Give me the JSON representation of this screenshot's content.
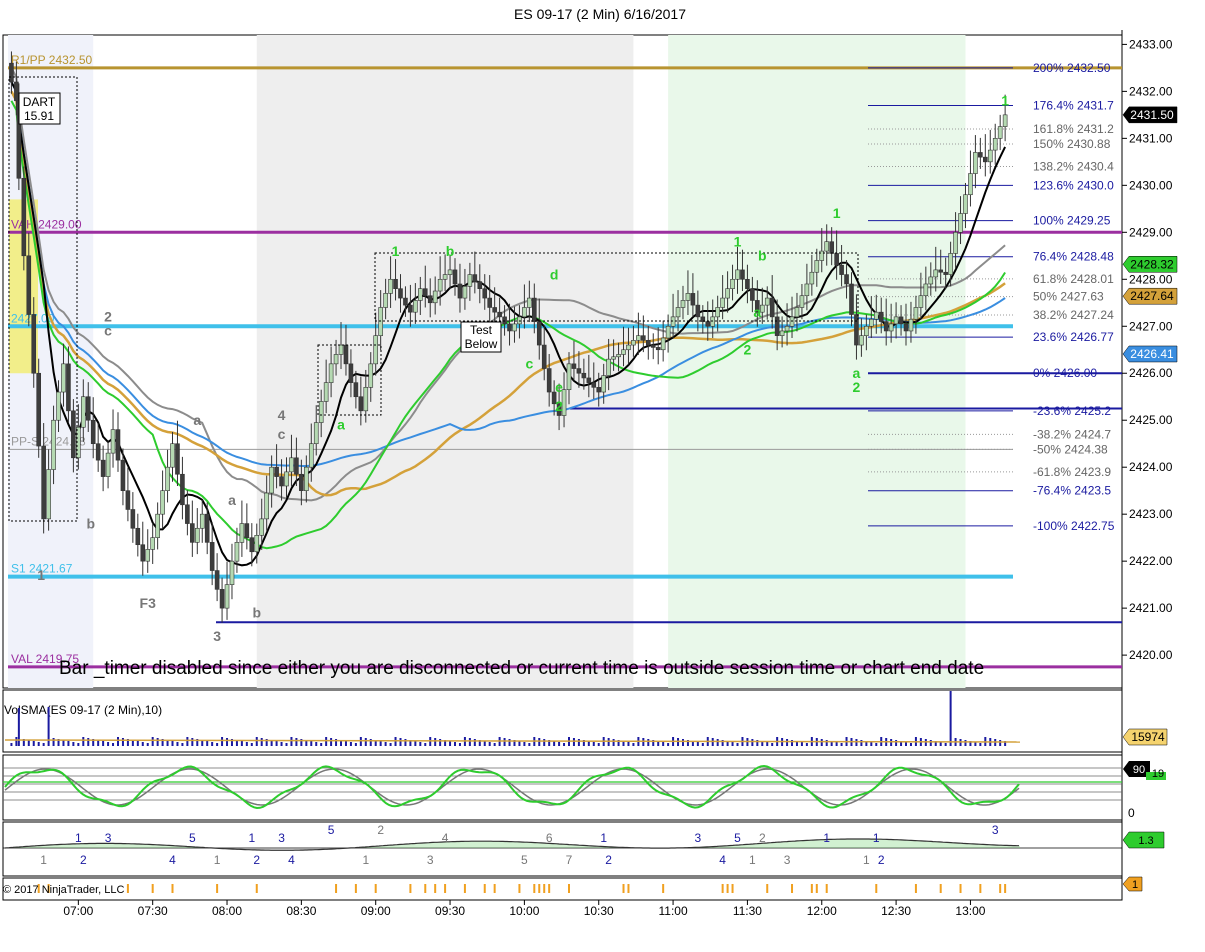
{
  "title": "ES 09-17 (2 Min)  6/16/2017",
  "copyright": "© 2017 NinjaTrader, LLC",
  "bar_timer_message": "Bar _timer disabled since either you are disconnected or current time is outside session time or chart end date",
  "dart_box": {
    "line1": "DART",
    "line2": "15.91"
  },
  "test_below": {
    "line1": "Test",
    "line2": "Below"
  },
  "colors": {
    "bg": "#ffffff",
    "session_shade": "#eeeeee",
    "early_shade": "#f0f2fa",
    "green_shade": "#e9f8ea",
    "up_bar": "#b5d9b2",
    "down_bar": "#3d3d3d",
    "fib": "#1a1aa0",
    "ema_black": "#000000",
    "ma_gray": "#8c8c8c",
    "ma_gold": "#d4a13a",
    "ma_blue": "#3a8ee0",
    "ma_green": "#2ecc2e",
    "pivot_line": "#b89430",
    "cyan": "#3fc0ea",
    "purple": "#9b2fa0"
  },
  "chart_data": {
    "type": "candlestick",
    "instrument": "ES 09-17",
    "interval": "2 Min",
    "date": "6/16/2017",
    "y_axis": {
      "min": 2419.3,
      "max": 2433.2,
      "ticks": [
        2433.0,
        2432.0,
        2431.0,
        2430.0,
        2429.0,
        2428.0,
        2427.0,
        2426.0,
        2425.0,
        2424.0,
        2423.0,
        2422.0,
        2421.0,
        2420.0
      ]
    },
    "x_axis": {
      "ticks": [
        "07:00",
        "07:30",
        "08:00",
        "08:30",
        "09:00",
        "09:30",
        "10:00",
        "10:30",
        "11:00",
        "11:30",
        "12:00",
        "12:30",
        "13:00"
      ]
    },
    "price_points": [
      [
        "06:35",
        2431.8
      ],
      [
        "06:38",
        2428.5
      ],
      [
        "06:42",
        2426.0
      ],
      [
        "06:46",
        2422.9
      ],
      [
        "06:50",
        2425.0
      ],
      [
        "06:54",
        2426.2
      ],
      [
        "06:58",
        2424.2
      ],
      [
        "07:02",
        2425.5
      ],
      [
        "07:06",
        2424.5
      ],
      [
        "07:10",
        2423.8
      ],
      [
        "07:14",
        2424.8
      ],
      [
        "07:18",
        2423.5
      ],
      [
        "07:22",
        2422.7
      ],
      [
        "07:26",
        2422.0
      ],
      [
        "07:30",
        2422.5
      ],
      [
        "07:34",
        2423.5
      ],
      [
        "07:38",
        2424.5
      ],
      [
        "07:42",
        2423.2
      ],
      [
        "07:46",
        2422.4
      ],
      [
        "07:50",
        2423.0
      ],
      [
        "07:54",
        2421.8
      ],
      [
        "07:58",
        2421.0
      ],
      [
        "08:02",
        2422.0
      ],
      [
        "08:06",
        2422.8
      ],
      [
        "08:10",
        2422.2
      ],
      [
        "08:14",
        2422.9
      ],
      [
        "08:18",
        2424.0
      ],
      [
        "08:22",
        2423.6
      ],
      [
        "08:26",
        2424.2
      ],
      [
        "08:30",
        2423.5
      ],
      [
        "08:34",
        2424.5
      ],
      [
        "08:38",
        2425.4
      ],
      [
        "08:42",
        2426.2
      ],
      [
        "08:46",
        2426.6
      ],
      [
        "08:50",
        2425.8
      ],
      [
        "08:54",
        2425.2
      ],
      [
        "08:58",
        2426.2
      ],
      [
        "09:02",
        2427.4
      ],
      [
        "09:06",
        2428.0
      ],
      [
        "09:10",
        2427.6
      ],
      [
        "09:14",
        2427.3
      ],
      [
        "09:18",
        2427.8
      ],
      [
        "09:22",
        2427.5
      ],
      [
        "09:26",
        2428.0
      ],
      [
        "09:30",
        2428.2
      ],
      [
        "09:34",
        2427.6
      ],
      [
        "09:38",
        2428.1
      ],
      [
        "09:42",
        2427.8
      ],
      [
        "09:46",
        2427.4
      ],
      [
        "09:50",
        2427.2
      ],
      [
        "09:54",
        2426.9
      ],
      [
        "09:58",
        2427.2
      ],
      [
        "10:02",
        2427.6
      ],
      [
        "10:06",
        2426.6
      ],
      [
        "10:10",
        2425.6
      ],
      [
        "10:14",
        2425.1
      ],
      [
        "10:18",
        2426.2
      ],
      [
        "10:22",
        2426.0
      ],
      [
        "10:26",
        2425.8
      ],
      [
        "10:30",
        2425.6
      ],
      [
        "10:34",
        2426.3
      ],
      [
        "10:38",
        2426.4
      ],
      [
        "10:42",
        2426.6
      ],
      [
        "10:46",
        2426.8
      ],
      [
        "10:50",
        2426.6
      ],
      [
        "10:54",
        2426.5
      ],
      [
        "10:58",
        2427.0
      ],
      [
        "11:02",
        2427.4
      ],
      [
        "11:06",
        2427.7
      ],
      [
        "11:10",
        2427.2
      ],
      [
        "11:14",
        2427.0
      ],
      [
        "11:18",
        2427.4
      ],
      [
        "11:22",
        2427.8
      ],
      [
        "11:26",
        2428.2
      ],
      [
        "11:30",
        2427.8
      ],
      [
        "11:34",
        2427.3
      ],
      [
        "11:38",
        2427.6
      ],
      [
        "11:42",
        2426.8
      ],
      [
        "11:46",
        2427.0
      ],
      [
        "11:50",
        2427.4
      ],
      [
        "11:54",
        2427.9
      ],
      [
        "11:58",
        2428.4
      ],
      [
        "12:02",
        2428.8
      ],
      [
        "12:06",
        2428.3
      ],
      [
        "12:10",
        2427.9
      ],
      [
        "12:14",
        2426.6
      ],
      [
        "12:18",
        2427.0
      ],
      [
        "12:22",
        2427.3
      ],
      [
        "12:26",
        2426.9
      ],
      [
        "12:30",
        2427.2
      ],
      [
        "12:34",
        2426.9
      ],
      [
        "12:38",
        2427.4
      ],
      [
        "12:42",
        2427.9
      ],
      [
        "12:46",
        2428.2
      ],
      [
        "12:50",
        2428.1
      ],
      [
        "12:54",
        2429.0
      ],
      [
        "12:58",
        2429.8
      ],
      [
        "13:02",
        2430.7
      ],
      [
        "13:06",
        2430.5
      ],
      [
        "13:10",
        2431.0
      ],
      [
        "13:14",
        2431.5
      ]
    ],
    "horizontal_levels": [
      {
        "label": "R1/PP 2432.50",
        "value": 2432.5,
        "color": "#b89430"
      },
      {
        "label": "VAH 2429.00",
        "value": 2429.0,
        "color": "#9b2fa0"
      },
      {
        "label": "2427.00",
        "value": 2427.0,
        "color": "#3fc0ea"
      },
      {
        "label": "PP-S 2424.38",
        "value": 2424.38,
        "color": "#9a9a9a"
      },
      {
        "label": "S1 2421.67",
        "value": 2421.67,
        "color": "#3fc0ea"
      },
      {
        "label": "VAL 2419.75",
        "value": 2419.75,
        "color": "#9b2fa0"
      }
    ],
    "fib_levels": [
      {
        "label": "200%  2432.50",
        "value": 2432.5,
        "dark": true
      },
      {
        "label": "176.4%  2431.7",
        "value": 2431.7,
        "dark": true
      },
      {
        "label": "161.8%  2431.2",
        "value": 2431.2,
        "dark": false
      },
      {
        "label": "150%  2430.88",
        "value": 2430.88,
        "dark": false
      },
      {
        "label": "138.2%  2430.4",
        "value": 2430.4,
        "dark": false
      },
      {
        "label": "123.6%  2430.0",
        "value": 2430.0,
        "dark": true
      },
      {
        "label": "100%  2429.25",
        "value": 2429.25,
        "dark": true
      },
      {
        "label": "76.4%  2428.48",
        "value": 2428.48,
        "dark": true
      },
      {
        "label": "61.8%  2428.01",
        "value": 2428.01,
        "dark": false
      },
      {
        "label": "50%  2427.63",
        "value": 2427.63,
        "dark": false
      },
      {
        "label": "38.2%  2427.24",
        "value": 2427.24,
        "dark": false
      },
      {
        "label": "23.6%  2426.77",
        "value": 2426.77,
        "dark": true
      },
      {
        "label": "0%  2426.00",
        "value": 2426.0,
        "dark": true
      },
      {
        "label": "-23.6%  2425.2",
        "value": 2425.2,
        "dark": true
      },
      {
        "label": "-38.2%  2424.7",
        "value": 2424.7,
        "dark": false
      },
      {
        "label": "-50%  2424.38",
        "value": 2424.38,
        "dark": false
      },
      {
        "label": "-61.8%  2423.9",
        "value": 2423.9,
        "dark": false
      },
      {
        "label": "-76.4%  2423.5",
        "value": 2423.5,
        "dark": true
      },
      {
        "label": "-100%  2422.75",
        "value": 2422.75,
        "dark": true
      }
    ],
    "price_badges": [
      {
        "label": "2431.50",
        "value": 2431.5,
        "bg": "#000000",
        "fg": "#ffffff"
      },
      {
        "label": "2428.32",
        "value": 2428.32,
        "bg": "#2ecc2e",
        "fg": "#000000"
      },
      {
        "label": "2427.64",
        "value": 2427.64,
        "bg": "#d4a13a",
        "fg": "#000000"
      },
      {
        "label": "2426.41",
        "value": 2426.41,
        "bg": "#3a8ee0",
        "fg": "#ffffff"
      }
    ],
    "wave_labels": [
      {
        "text": "1",
        "time": "06:45",
        "value": 2421.6,
        "color": "#777777"
      },
      {
        "text": "2",
        "time": "07:12",
        "value": 2427.1,
        "color": "#777777"
      },
      {
        "text": "c",
        "time": "07:12",
        "value": 2426.8,
        "color": "#777777"
      },
      {
        "text": "b",
        "time": "07:05",
        "value": 2422.7,
        "color": "#777777"
      },
      {
        "text": "F3",
        "time": "07:28",
        "value": 2421.0,
        "color": "#777777"
      },
      {
        "text": "a",
        "time": "07:48",
        "value": 2424.9,
        "color": "#777777"
      },
      {
        "text": "3",
        "time": "07:56",
        "value": 2420.3,
        "color": "#777777"
      },
      {
        "text": "a",
        "time": "08:02",
        "value": 2423.2,
        "color": "#777777"
      },
      {
        "text": "b",
        "time": "08:12",
        "value": 2420.8,
        "color": "#777777"
      },
      {
        "text": "4",
        "time": "08:22",
        "value": 2425.0,
        "color": "#777777"
      },
      {
        "text": "c",
        "time": "08:22",
        "value": 2424.6,
        "color": "#777777"
      },
      {
        "text": "a",
        "time": "08:46",
        "value": 2424.8,
        "color": "#2ecc2e"
      },
      {
        "text": "1",
        "time": "09:08",
        "value": 2428.5,
        "color": "#2ecc2e"
      },
      {
        "text": "b",
        "time": "09:30",
        "value": 2428.5,
        "color": "#2ecc2e"
      },
      {
        "text": "d",
        "time": "10:12",
        "value": 2428.0,
        "color": "#2ecc2e"
      },
      {
        "text": "e",
        "time": "10:14",
        "value": 2425.6,
        "color": "#2ecc2e"
      },
      {
        "text": "2",
        "time": "10:14",
        "value": 2425.2,
        "color": "#2ecc2e"
      },
      {
        "text": "c",
        "time": "10:02",
        "value": 2426.1,
        "color": "#2ecc2e"
      },
      {
        "text": "1",
        "time": "11:26",
        "value": 2428.7,
        "color": "#2ecc2e"
      },
      {
        "text": "b",
        "time": "11:36",
        "value": 2428.4,
        "color": "#2ecc2e"
      },
      {
        "text": "a",
        "time": "11:34",
        "value": 2427.2,
        "color": "#2ecc2e"
      },
      {
        "text": "2",
        "time": "11:30",
        "value": 2426.4,
        "color": "#2ecc2e"
      },
      {
        "text": "1",
        "time": "12:06",
        "value": 2429.3,
        "color": "#2ecc2e"
      },
      {
        "text": "a",
        "time": "12:14",
        "value": 2425.9,
        "color": "#2ecc2e"
      },
      {
        "text": "2",
        "time": "12:14",
        "value": 2425.6,
        "color": "#2ecc2e"
      },
      {
        "text": "1",
        "time": "13:14",
        "value": 2431.7,
        "color": "#2ecc2e"
      }
    ],
    "volume_panel": {
      "label": "VolSMA(ES 09-17 (2 Min),10)",
      "badge": "15974"
    },
    "oscillator_panel": {
      "labels": [
        "90",
        "19",
        "0"
      ]
    },
    "wave_count_panel": {
      "labels": [
        {
          "text": "1",
          "time": "06:46",
          "color": "#777777",
          "row": "low"
        },
        {
          "text": "1",
          "time": "07:00",
          "color": "#1a1aa0",
          "row": "high"
        },
        {
          "text": "2",
          "time": "07:02",
          "color": "#1a1aa0",
          "row": "low"
        },
        {
          "text": "3",
          "time": "07:12",
          "color": "#1a1aa0",
          "row": "high"
        },
        {
          "text": "4",
          "time": "07:38",
          "color": "#1a1aa0",
          "row": "low"
        },
        {
          "text": "5",
          "time": "07:46",
          "color": "#1a1aa0",
          "row": "high"
        },
        {
          "text": "1",
          "time": "07:56",
          "color": "#777777",
          "row": "low"
        },
        {
          "text": "1",
          "time": "08:10",
          "color": "#1a1aa0",
          "row": "high"
        },
        {
          "text": "2",
          "time": "08:12",
          "color": "#1a1aa0",
          "row": "low"
        },
        {
          "text": "3",
          "time": "08:22",
          "color": "#1a1aa0",
          "row": "high"
        },
        {
          "text": "4",
          "time": "08:26",
          "color": "#1a1aa0",
          "row": "low"
        },
        {
          "text": "5",
          "time": "08:42",
          "color": "#1a1aa0",
          "row": "top"
        },
        {
          "text": "1",
          "time": "08:56",
          "color": "#777777",
          "row": "low"
        },
        {
          "text": "2",
          "time": "09:02",
          "color": "#777777",
          "row": "top"
        },
        {
          "text": "3",
          "time": "09:22",
          "color": "#777777",
          "row": "low"
        },
        {
          "text": "4",
          "time": "09:28",
          "color": "#777777",
          "row": "high"
        },
        {
          "text": "5",
          "time": "10:00",
          "color": "#777777",
          "row": "low"
        },
        {
          "text": "6",
          "time": "10:10",
          "color": "#777777",
          "row": "high"
        },
        {
          "text": "7",
          "time": "10:18",
          "color": "#777777",
          "row": "low"
        },
        {
          "text": "1",
          "time": "10:32",
          "color": "#1a1aa0",
          "row": "high"
        },
        {
          "text": "2",
          "time": "10:34",
          "color": "#1a1aa0",
          "row": "low"
        },
        {
          "text": "3",
          "time": "11:10",
          "color": "#1a1aa0",
          "row": "high"
        },
        {
          "text": "4",
          "time": "11:20",
          "color": "#1a1aa0",
          "row": "low"
        },
        {
          "text": "5",
          "time": "11:26",
          "color": "#1a1aa0",
          "row": "high"
        },
        {
          "text": "1",
          "time": "11:32",
          "color": "#777777",
          "row": "low"
        },
        {
          "text": "2",
          "time": "11:36",
          "color": "#777777",
          "row": "high"
        },
        {
          "text": "3",
          "time": "11:46",
          "color": "#777777",
          "row": "low"
        },
        {
          "text": "1",
          "time": "12:02",
          "color": "#1a1aa0",
          "row": "high"
        },
        {
          "text": "1",
          "time": "12:18",
          "color": "#777777",
          "row": "low"
        },
        {
          "text": "1",
          "time": "12:22",
          "color": "#1a1aa0",
          "row": "high"
        },
        {
          "text": "2",
          "time": "12:24",
          "color": "#1a1aa0",
          "row": "low"
        },
        {
          "text": "3",
          "time": "13:10",
          "color": "#1a1aa0",
          "row": "top"
        }
      ],
      "badge": "1.3"
    },
    "bottom_panel": {
      "badge": "1"
    }
  }
}
